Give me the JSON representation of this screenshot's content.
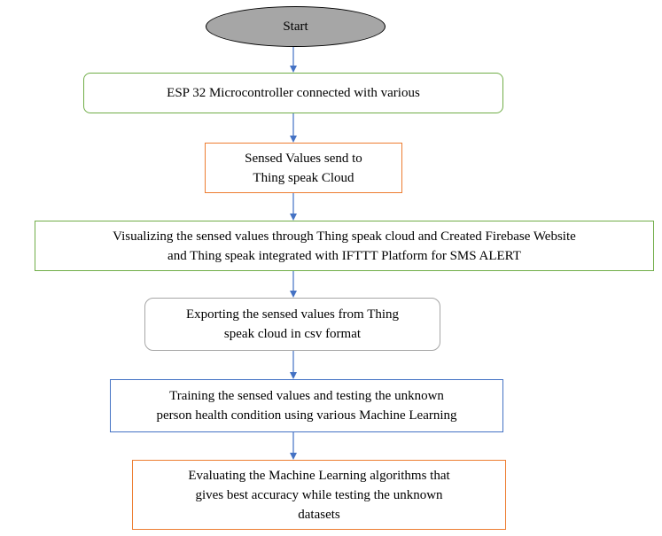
{
  "start": {
    "label": "Start"
  },
  "steps": [
    {
      "lines": [
        "ESP 32 Microcontroller connected with various"
      ]
    },
    {
      "lines": [
        "Sensed Values send to",
        "Thing speak Cloud"
      ]
    },
    {
      "lines": [
        "Visualizing the sensed values through Thing speak cloud and Created Firebase Website",
        "and Thing speak integrated with IFTTT Platform for SMS ALERT"
      ]
    },
    {
      "lines": [
        "Exporting the sensed values from Thing",
        "speak cloud in csv format"
      ]
    },
    {
      "lines": [
        "Training the sensed values and testing the unknown",
        "person health condition using various Machine Learning"
      ]
    },
    {
      "lines": [
        "Evaluating the Machine Learning algorithms that",
        "gives best accuracy while testing the unknown",
        "datasets"
      ]
    }
  ],
  "colors": {
    "arrow": "#4472c4",
    "start_fill": "#a6a6a6",
    "green_border": "#70ad47",
    "orange_border": "#ed7d31",
    "gray_border": "#a6a6a6",
    "blue_border": "#4472c4"
  }
}
